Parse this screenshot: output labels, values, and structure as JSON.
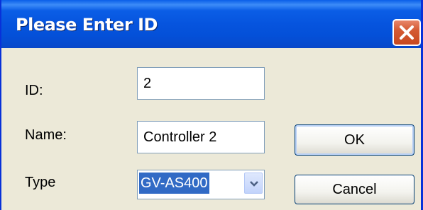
{
  "dialog": {
    "title": "Please Enter ID"
  },
  "form": {
    "id_label": "ID:",
    "id_value": "2",
    "name_label": "Name:",
    "name_value": "Controller 2",
    "type_label": "Type",
    "type_value": "GV-AS400"
  },
  "buttons": {
    "ok_label": "OK",
    "cancel_label": "Cancel"
  },
  "colors": {
    "titlebar": "#0654de",
    "selection": "#316ac5",
    "close": "#d45a33"
  },
  "icons": {
    "close": "close-icon",
    "dropdown": "chevron-down-icon"
  }
}
